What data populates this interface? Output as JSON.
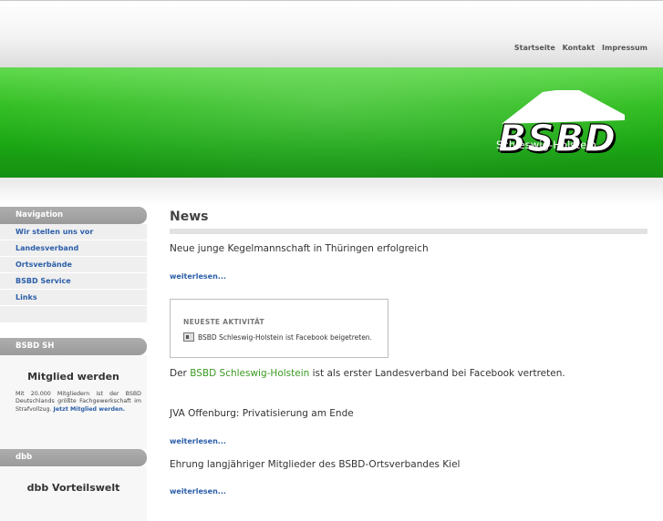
{
  "topnav": [
    {
      "label": "Startseite"
    },
    {
      "label": "Kontakt"
    },
    {
      "label": "Impressum"
    }
  ],
  "logo": {
    "title": "BSBD",
    "subtitle": "Schleswig-Holstein"
  },
  "sidebar": {
    "navigation": {
      "heading": "Navigation",
      "items": [
        {
          "label": "Wir stellen uns vor"
        },
        {
          "label": "Landesverband"
        },
        {
          "label": "Ortsverbände"
        },
        {
          "label": "BSBD Service"
        },
        {
          "label": "Links"
        }
      ]
    },
    "bsbd_sh": {
      "heading": "BSBD SH",
      "block_title": "Mitglied werden",
      "text": "Mit 20.000 Mitgliedern ist der BSBD Deutschlands größte Fachgewerkschaft im Strafvollzug.",
      "link": "Jetzt Mitglied werden."
    },
    "dbb": {
      "heading": "dbb",
      "block_title": "dbb Vorteilswelt"
    }
  },
  "content": {
    "title": "News",
    "items": [
      {
        "title": "Neue junge Kegelmannschaft in Thüringen erfolgreich",
        "more": "weiterlesen..."
      },
      {
        "title": "JVA Offenburg: Privatisierung am Ende",
        "more": "weiterlesen..."
      },
      {
        "title": "Ehrung langjähriger Mitglieder des BSBD-Ortsverbandes Kiel",
        "more": "weiterlesen..."
      }
    ],
    "facebook_box": {
      "heading": "NEUESTE AKTIVITÄT",
      "activity": "BSBD Schleswig-Holstein ist Facebook beigetreten."
    },
    "facebook_text": {
      "prefix": "Der",
      "link": "BSBD Schleswig-Holstein",
      "suffix": "ist als erster Landesverband bei Facebook vertreten."
    }
  },
  "colors": {
    "brand_green": "#2fbd1f",
    "link_blue": "#2b5ea8",
    "sidebar_header": "#a5a5a5"
  }
}
